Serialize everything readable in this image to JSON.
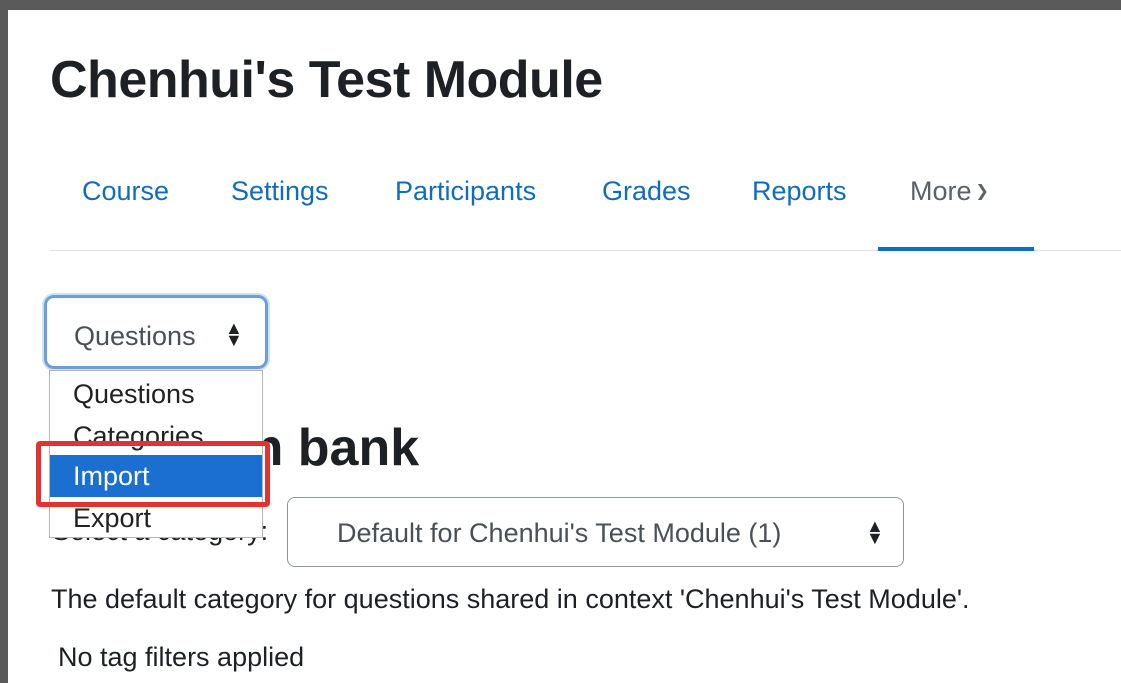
{
  "course": {
    "title": "Chenhui's Test Module"
  },
  "nav": {
    "items": [
      {
        "label": "Course"
      },
      {
        "label": "Settings"
      },
      {
        "label": "Participants"
      },
      {
        "label": "Grades"
      },
      {
        "label": "Reports"
      }
    ],
    "more_label": "More",
    "active": "More"
  },
  "bank_select": {
    "value": "Questions",
    "options": [
      "Questions",
      "Categories",
      "Import",
      "Export"
    ],
    "highlighted": "Import"
  },
  "page": {
    "heading": "Question bank"
  },
  "category": {
    "label": "Select a category:",
    "value": "Default for Chenhui's Test Module (1)",
    "description": "The default category for questions shared in context 'Chenhui's Test Module'."
  },
  "tags": {
    "status": "No tag filters applied"
  },
  "colors": {
    "link": "#0f6cbf",
    "selected_option": "#1a6fd1",
    "annotation": "#e4332f",
    "focus_ring": "#6b9fd8"
  },
  "icons": {
    "more_chevron": "chevron-down-icon",
    "select_arrows": "sort-arrows-icon"
  }
}
